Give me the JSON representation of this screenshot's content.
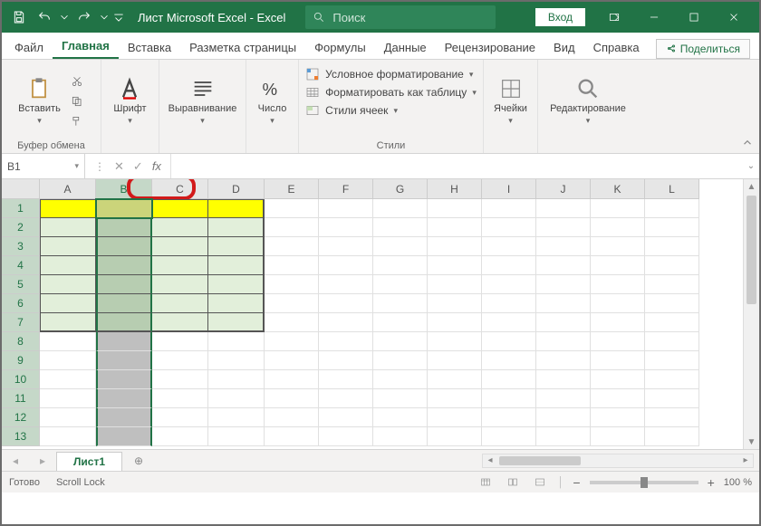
{
  "window": {
    "title": "Лист Microsoft Excel  -  Excel"
  },
  "search": {
    "placeholder": "Поиск"
  },
  "login": {
    "label": "Вход"
  },
  "tabs": {
    "file": "Файл",
    "home": "Главная",
    "insert": "Вставка",
    "page_layout": "Разметка страницы",
    "formulas": "Формулы",
    "data": "Данные",
    "review": "Рецензирование",
    "view": "Вид",
    "help": "Справка"
  },
  "share": {
    "label": "Поделиться"
  },
  "ribbon": {
    "clipboard": {
      "paste": "Вставить",
      "label": "Буфер обмена"
    },
    "font": {
      "btn": "Шрифт",
      "label": "Шрифт"
    },
    "alignment": {
      "btn": "Выравнивание",
      "label": ""
    },
    "number": {
      "btn": "Число",
      "label": ""
    },
    "styles": {
      "cond": "Условное форматирование",
      "table": "Форматировать как таблицу",
      "cell": "Стили ячеек",
      "label": "Стили"
    },
    "cells": {
      "btn": "Ячейки"
    },
    "editing": {
      "btn": "Редактирование"
    }
  },
  "name_box": {
    "value": "B1"
  },
  "columns": [
    "A",
    "B",
    "C",
    "D",
    "E",
    "F",
    "G",
    "H",
    "I",
    "J",
    "K",
    "L"
  ],
  "rows": [
    "1",
    "2",
    "3",
    "4",
    "5",
    "6",
    "7",
    "8",
    "9",
    "10",
    "11",
    "12",
    "13"
  ],
  "sheet": {
    "tab1": "Лист1"
  },
  "status": {
    "ready": "Готово",
    "scroll": "Scroll Lock",
    "zoom": "100 %"
  },
  "colors": {
    "yellow": "#ffff00",
    "light_green": "#e2efda",
    "sel_green": "#b7cdb1",
    "grid_sel_grey": "#bfbfbf",
    "accent": "#217346"
  }
}
